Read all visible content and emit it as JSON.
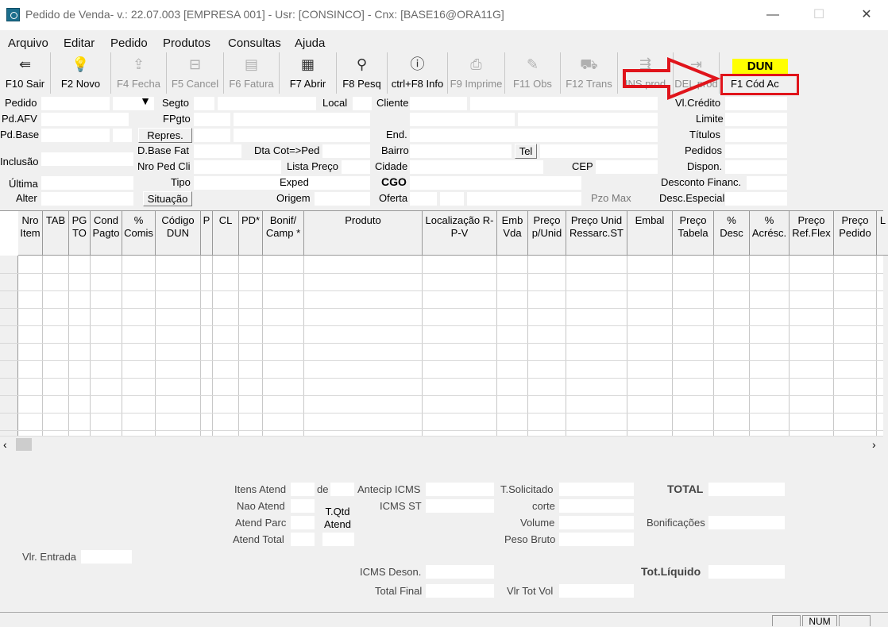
{
  "window": {
    "title": "Pedido de Venda- v.: 22.07.003  [EMPRESA 001] - Usr: [CONSINCO] - Cnx: [BASE16@ORA11G]",
    "minimize": "—",
    "maximize": "☐",
    "close": "✕"
  },
  "menu": [
    "Arquivo",
    "Editar",
    "Pedido",
    "Produtos",
    "Consultas",
    "Ajuda"
  ],
  "toolbar": [
    {
      "label": "F10 Sair",
      "icon": "exit-icon",
      "glyph": "⇚",
      "enabled": true
    },
    {
      "label": "F2 Novo",
      "icon": "lightbulb-icon",
      "glyph": "💡",
      "enabled": true
    },
    {
      "label": "F4 Fecha",
      "icon": "close-order-icon",
      "glyph": "⇪",
      "enabled": false
    },
    {
      "label": "F5 Cancel",
      "icon": "cancel-icon",
      "glyph": "⊟",
      "enabled": false
    },
    {
      "label": "F6 Fatura",
      "icon": "invoice-icon",
      "glyph": "▤",
      "enabled": false
    },
    {
      "label": "F7 Abrir",
      "icon": "open-icon",
      "glyph": "▦",
      "enabled": true
    },
    {
      "label": "F8 Pesq",
      "icon": "binoculars-icon",
      "glyph": "⚲",
      "enabled": true
    },
    {
      "label": "ctrl+F8 Info",
      "icon": "info-icon",
      "glyph": "ⓘ",
      "enabled": true
    },
    {
      "label": "F9 Imprime",
      "icon": "printer-icon",
      "glyph": "⎙",
      "enabled": false
    },
    {
      "label": "F11 Obs",
      "icon": "notes-icon",
      "glyph": "✎",
      "enabled": false
    },
    {
      "label": "F12 Trans",
      "icon": "truck-icon",
      "glyph": "⛟",
      "enabled": false
    },
    {
      "label": "INS prod",
      "icon": "insert-product-icon",
      "glyph": "⇶",
      "enabled": false
    },
    {
      "label": "DEL prod",
      "icon": "delete-product-icon",
      "glyph": "⇥",
      "enabled": false
    }
  ],
  "dun": {
    "badge": "DUN",
    "button": "F1 Cód Ac"
  },
  "form": {
    "pedido": "Pedido",
    "segto": "Segto",
    "local": "Local",
    "cliente": "Cliente",
    "vlcredito": "Vl.Crédito",
    "pdafv": "Pd.AFV",
    "fpgto": "FPgto",
    "limite": "Limite",
    "pdbase": "Pd.Base",
    "repres": "Repres.",
    "end": "End.",
    "titulos": "Títulos",
    "dbasefat": "D.Base Fat",
    "dtcot": "Dta Cot=>Ped",
    "bairro": "Bairro",
    "tel": "Tel",
    "pedidos": "Pedidos",
    "inclusao": "Inclusão",
    "nropedcli": "Nro Ped Cli",
    "listapreco": "Lista Preço",
    "cidade": "Cidade",
    "cep": "CEP",
    "dispon": "Dispon.",
    "ultima": "Última",
    "tipo": "Tipo",
    "descfin": "Desconto Financ.",
    "exped": "Exped",
    "cgo": "CGO",
    "alter": "Alter",
    "situacao": "Situação",
    "origem": "Origem",
    "oferta": "Oferta",
    "pzomax": "Pzo Max",
    "descesp": "Desc.Especial Cli."
  },
  "grid": {
    "columns": [
      "Nro Item",
      "TAB",
      "PG TO",
      "Cond Pagto",
      "% Comis",
      "Código DUN",
      "P",
      "CL",
      "PD*",
      "Bonif/ Camp *",
      "Produto",
      "Localização R-P-V",
      "Emb Vda",
      "Preço p/Unid",
      "Preço Unid Ressarc.ST",
      "Embal",
      "Preço Tabela",
      "% Desc",
      "% Acrésc.",
      "Preço Ref.Flex",
      "Preço Pedido",
      "L"
    ]
  },
  "totals": {
    "itensatend": "Itens Atend",
    "de": "de",
    "naoatend": "Nao Atend",
    "tqtd": "T.Qtd Atend",
    "atendparc": "Atend Parc",
    "atendtotal": "Atend Total",
    "antecip": "Antecip ICMS",
    "icmsst": "ICMS ST",
    "tsolicitado": "T.Solicitado",
    "corte": "corte",
    "volume": "Volume",
    "pesobruto": "Peso Bruto",
    "total": "TOTAL",
    "bonificacoes": "Bonificações",
    "vlrentrada": "Vlr. Entrada",
    "icmsdeson": "ICMS Deson.",
    "totalfinal": "Total Final",
    "vlrtotvol": "Vlr Tot Vol",
    "totliquido": "Tot.Líquido"
  },
  "statusbar": {
    "num": "NUM"
  }
}
